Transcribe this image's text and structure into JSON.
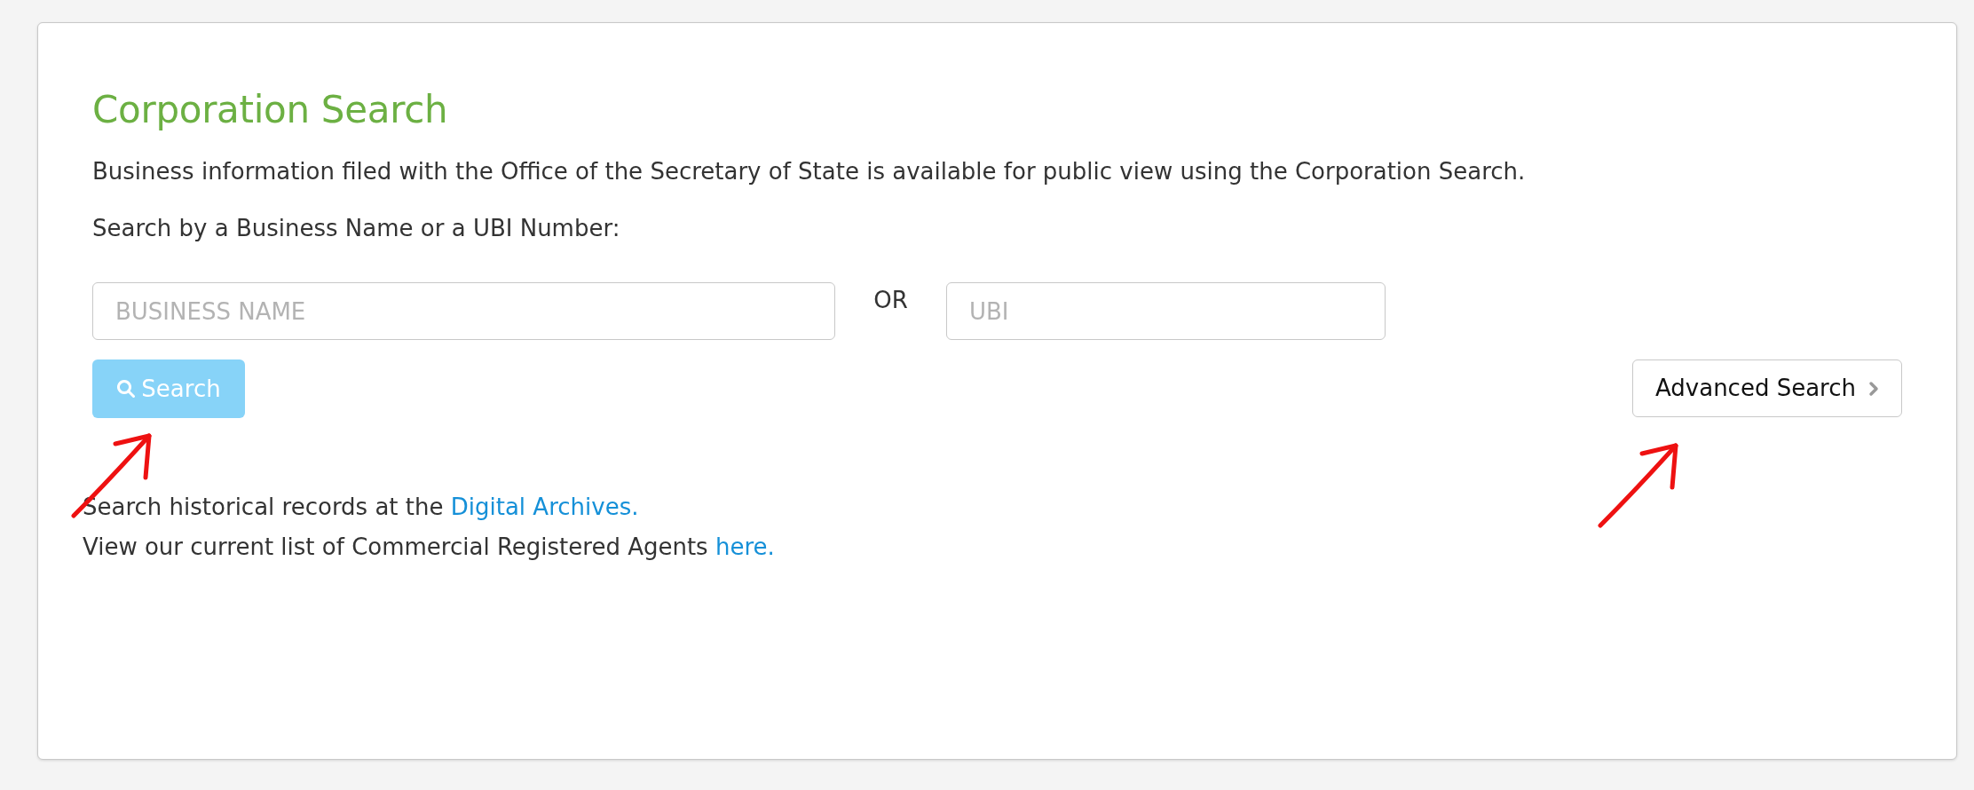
{
  "heading": {
    "title": "Corporation Search",
    "description": "Business information filed with the Office of the Secretary of State is available for public view using the Corporation Search.",
    "prompt": "Search by a Business Name or a UBI Number:"
  },
  "search_form": {
    "fields": [
      {
        "placeholder": "BUSINESS NAME"
      },
      {
        "placeholder": "UBI"
      }
    ],
    "separator": "OR",
    "search_button": {
      "label": "Search",
      "disabled": true,
      "marked_with_arrow": true
    },
    "advanced_button": {
      "label": "Advanced Search",
      "marked_with_arrow": true
    }
  },
  "links": [
    {
      "text": "Search historical records at the",
      "link": "Digital Archives."
    },
    {
      "text": "View our current list of Commercial Registered Agents",
      "link": "here."
    }
  ]
}
